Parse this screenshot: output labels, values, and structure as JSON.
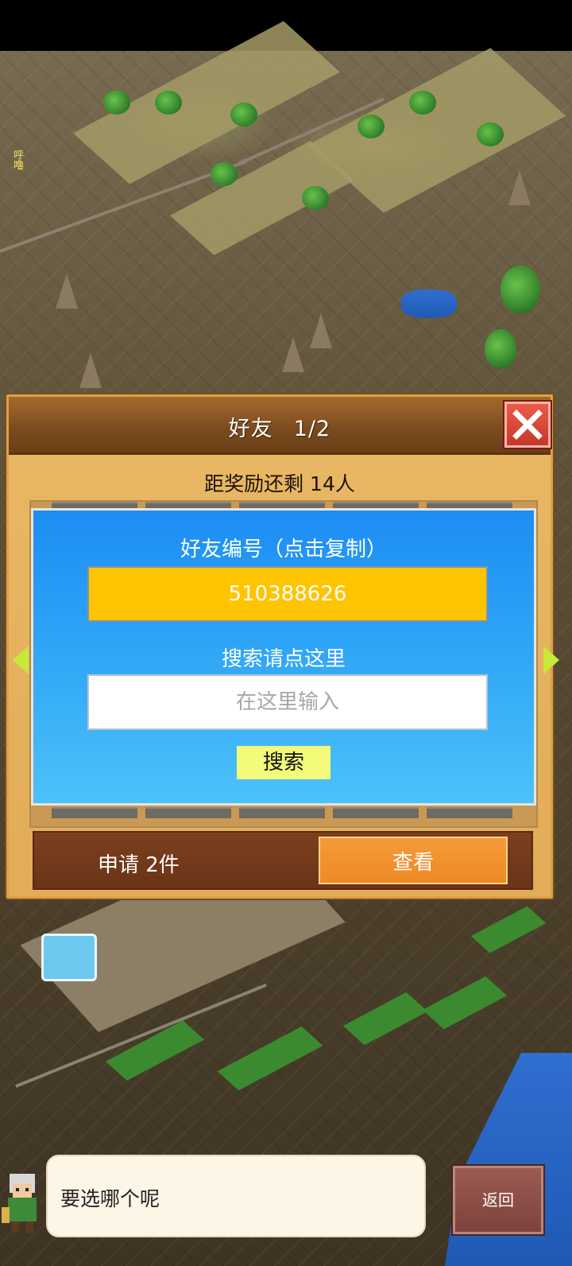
{
  "dialog": {
    "title": "好友",
    "page": "1/2",
    "reward_text": "距奖励还剩 14人"
  },
  "friend_panel": {
    "id_label": "好友编号（点击复制）",
    "id_value": "510388626",
    "search_label": "搜索请点这里",
    "search_placeholder": "在这里输入",
    "search_button": "搜索"
  },
  "requests": {
    "label": "申请 2件",
    "view_button": "查看"
  },
  "speech": {
    "text": "要选哪个呢"
  },
  "back_button": "返回",
  "world": {
    "npc_label": "呼噜"
  },
  "colors": {
    "panel_blue": "#1d8df3",
    "id_box_yellow": "#ffc400",
    "view_orange": "#f0902c",
    "close_red": "#e24a3c",
    "arrow_green": "#c8e83a"
  },
  "icons": [
    "close-icon",
    "arrow-left-icon",
    "arrow-right-icon",
    "npc-avatar-icon"
  ]
}
